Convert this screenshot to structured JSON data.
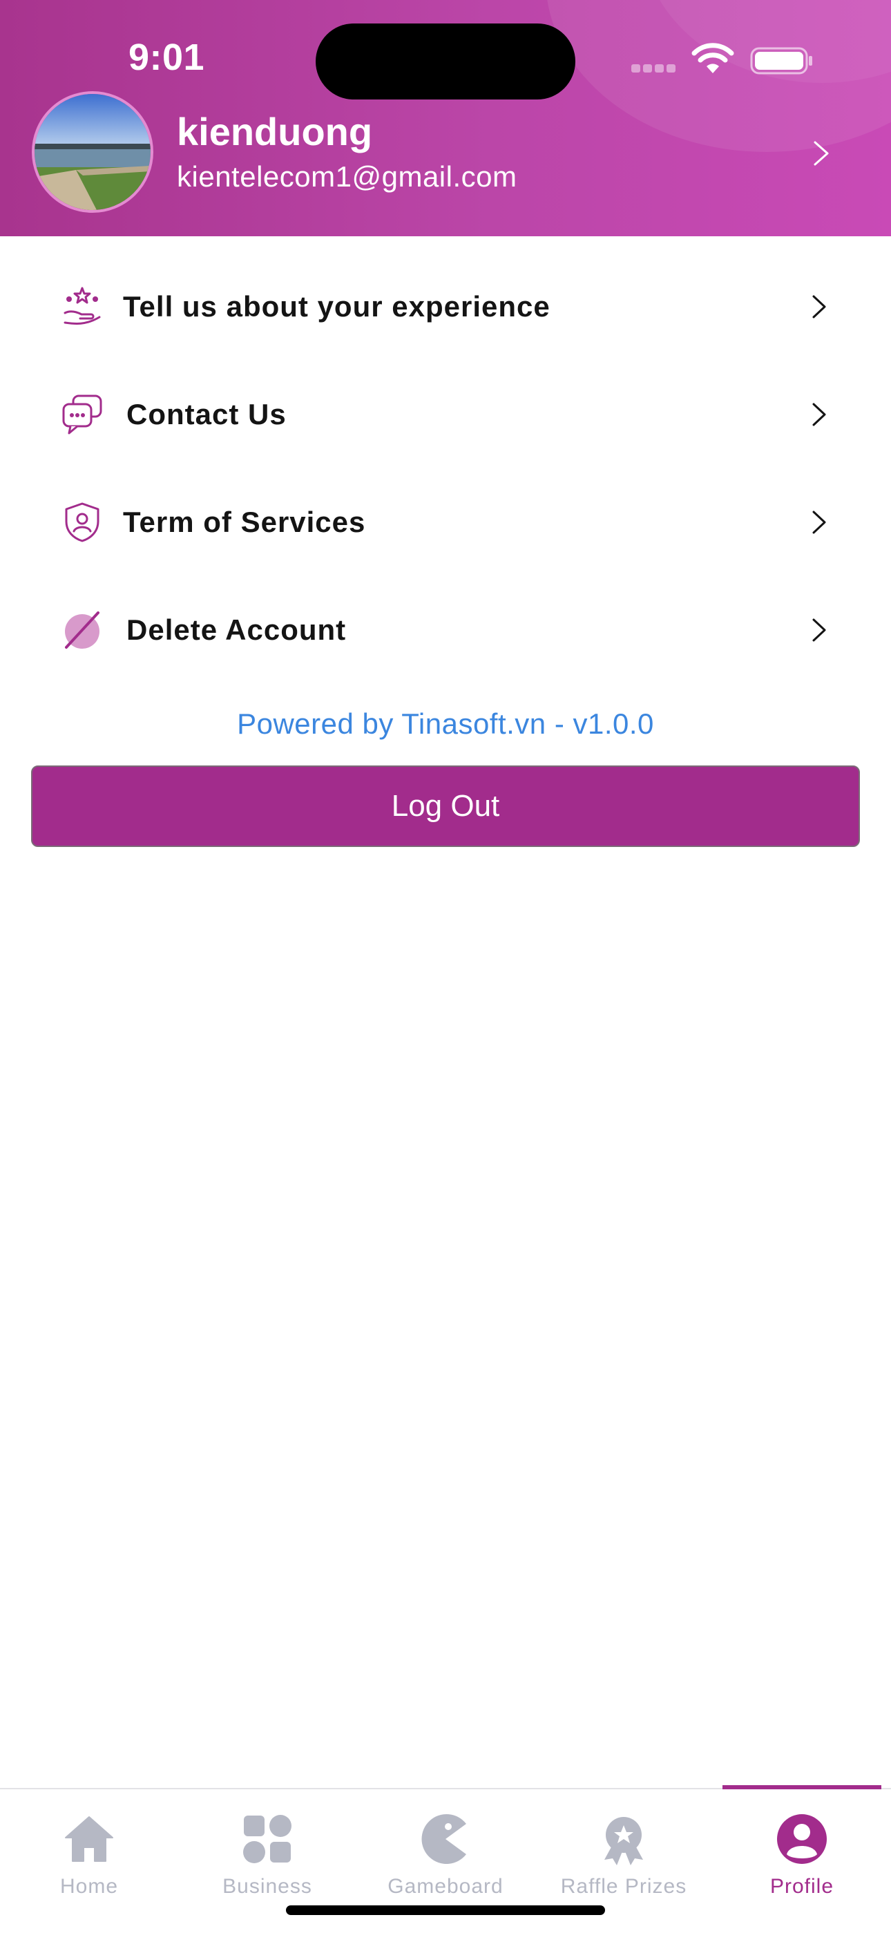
{
  "status_bar": {
    "time": "9:01"
  },
  "profile": {
    "name": "kienduong",
    "email": "kientelecom1@gmail.com"
  },
  "menu": [
    {
      "label": "Tell us about your experience",
      "icon": "review-stars-hand-icon"
    },
    {
      "label": "Contact Us",
      "icon": "chat-bubbles-icon"
    },
    {
      "label": "Term of Services",
      "icon": "shield-user-icon"
    },
    {
      "label": "Delete Account",
      "icon": "delete-account-icon"
    }
  ],
  "footer": {
    "powered_by": "Powered by Tinasoft.vn - v1.0.0",
    "logout_label": "Log Out"
  },
  "tabs": [
    {
      "label": "Home",
      "icon": "home-icon",
      "active": false
    },
    {
      "label": "Business",
      "icon": "grid-icon",
      "active": false
    },
    {
      "label": "Gameboard",
      "icon": "pacman-icon",
      "active": false
    },
    {
      "label": "Raffle Prizes",
      "icon": "award-badge-icon",
      "active": false
    },
    {
      "label": "Profile",
      "icon": "profile-icon",
      "active": true
    }
  ],
  "colors": {
    "brand": "#a22c8c",
    "header_gradient_start": "#a8348e",
    "header_gradient_end": "#c94ab6",
    "link_blue": "#3b86df",
    "tab_inactive": "#b5b8c4"
  }
}
